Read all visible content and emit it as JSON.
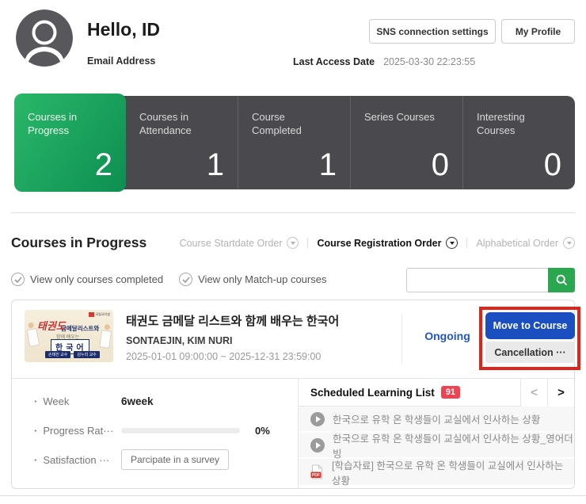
{
  "header": {
    "greeting": "Hello, ID",
    "email_label": "Email Address",
    "sns_button": "SNS connection settings",
    "profile_button": "My Profile",
    "last_access_label": "Last Access Date",
    "last_access_value": "2025-03-30 22:23:55"
  },
  "stats": {
    "tiles": [
      {
        "label": "Courses in Progress",
        "value": "2"
      },
      {
        "label": "Courses in Attendance",
        "value": "1"
      },
      {
        "label": "Course Completed",
        "value": "1"
      },
      {
        "label": "Series Courses",
        "value": "0"
      },
      {
        "label": "Interesting Courses",
        "value": "0"
      }
    ]
  },
  "section": {
    "title": "Courses in Progress",
    "sort_options": [
      {
        "label": "Course Startdate Order",
        "active": false
      },
      {
        "label": "Course Registration Order",
        "active": true
      },
      {
        "label": "Alphabetical Order",
        "active": false
      }
    ],
    "filters": [
      {
        "label": "View only courses completed"
      },
      {
        "label": "View only Match-up courses"
      }
    ]
  },
  "course": {
    "title": "태권도 금메달 리스트와 함께 배우는 한국어",
    "instructors": "SONTAEJIN, KIM NURI",
    "period": "2025-01-01 09:00:00 ~ 2025-12-31 23:59:00",
    "status": "Ongoing",
    "move_button": "Move to Course",
    "cancel_button": "Cancellation ···",
    "thumbnail": {
      "line1": "태권도",
      "line2": "금메달리스트와",
      "line3": "함께 배우는",
      "line4": "한국어",
      "logo_text": "국립국어원",
      "tag1": "손태진 교수",
      "tag2": "김누리 교수"
    },
    "details": {
      "week_label": "Week",
      "week_value": "6week",
      "progress_label": "Progress Rat···",
      "progress_value": "0%",
      "satisfaction_label": "Satisfaction ···",
      "survey_button": "Parcipate in a survey"
    }
  },
  "schedule": {
    "title": "Scheduled Learning List",
    "badge": "91",
    "items": [
      {
        "icon": "play",
        "text": "한국으로 유학 온 학생들이 교실에서 인사하는 상황"
      },
      {
        "icon": "play",
        "text": "한국으로 유학 온 학생들이 교실에서 인사하는 상황_영어더빙"
      },
      {
        "icon": "pdf",
        "text": "[학습자료] 한국으로 유학 온 학생들이 교실에서 인사하는 상황"
      }
    ]
  },
  "icons": {
    "pdf_label": "PDF"
  },
  "colors": {
    "accent_green": "#0d8e51",
    "dark_tile": "#4a4a4e",
    "primary_blue": "#1b4ec0",
    "status_blue": "#2356c5",
    "badge_red": "#f14251",
    "annotation_red": "#e2231a",
    "search_green": "#2ba84f"
  }
}
